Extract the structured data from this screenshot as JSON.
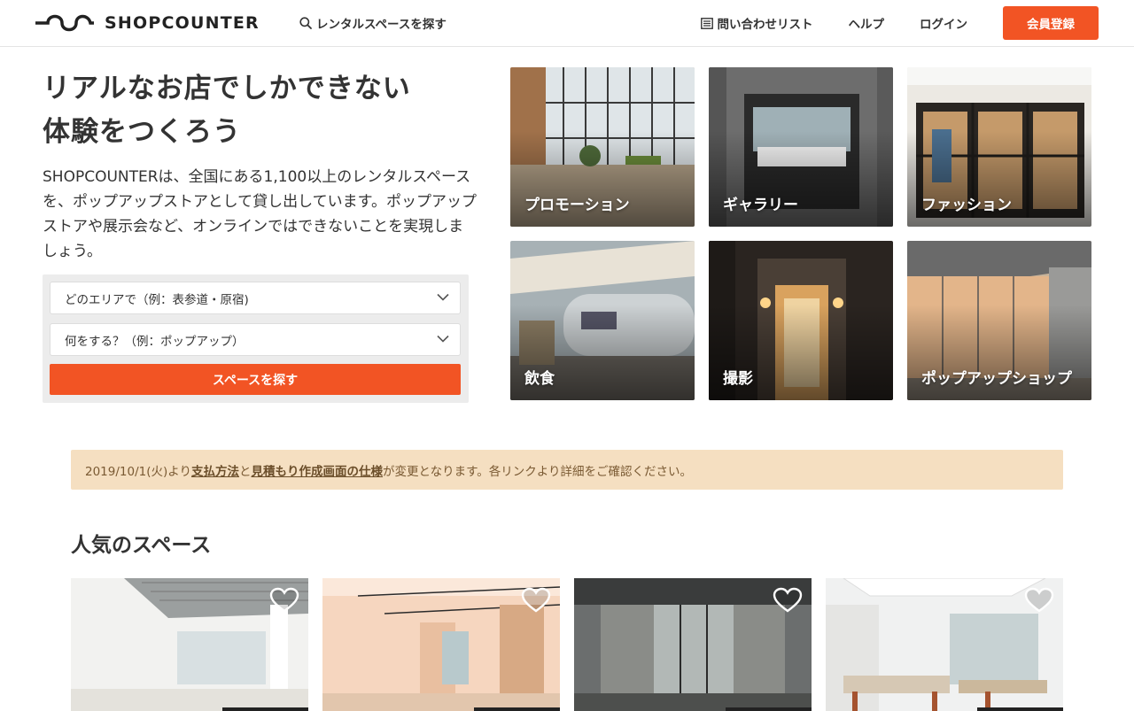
{
  "header": {
    "logo_text": "SHOPCOUNTER",
    "search_link": "レンタルスペースを探す",
    "inquiry_list": "問い合わせリスト",
    "help": "ヘルプ",
    "login": "ログイン",
    "signup": "会員登録"
  },
  "hero": {
    "title_line1": "リアルなお店でしかできない",
    "title_line2": "体験をつくろう",
    "description": "SHOPCOUNTERは、全国にある1,100以上のレンタルスペースを、ポップアップストアとして貸し出しています。ポップアップストアや展示会など、オンラインではできないことを実現しましょう。"
  },
  "search": {
    "area_select": "どのエリアで（例：表参道・原宿)",
    "purpose_select": "何をする？（例：ポップアップ）",
    "button": "スペースを探す"
  },
  "categories": [
    {
      "label": "プロモーション"
    },
    {
      "label": "ギャラリー"
    },
    {
      "label": "ファッション"
    },
    {
      "label": "飲食"
    },
    {
      "label": "撮影"
    },
    {
      "label": "ポップアップショップ"
    }
  ],
  "notice": {
    "prefix": "2019/10/1(火)より",
    "link1": "支払方法",
    "middle": "と",
    "link2": "見積もり作成画面の仕様",
    "suffix": "が変更となります。各リンクより詳細をご確認ください。"
  },
  "popular": {
    "title": "人気のスペース"
  },
  "colors": {
    "accent": "#f25424",
    "notice_bg": "#f5dfc1"
  }
}
